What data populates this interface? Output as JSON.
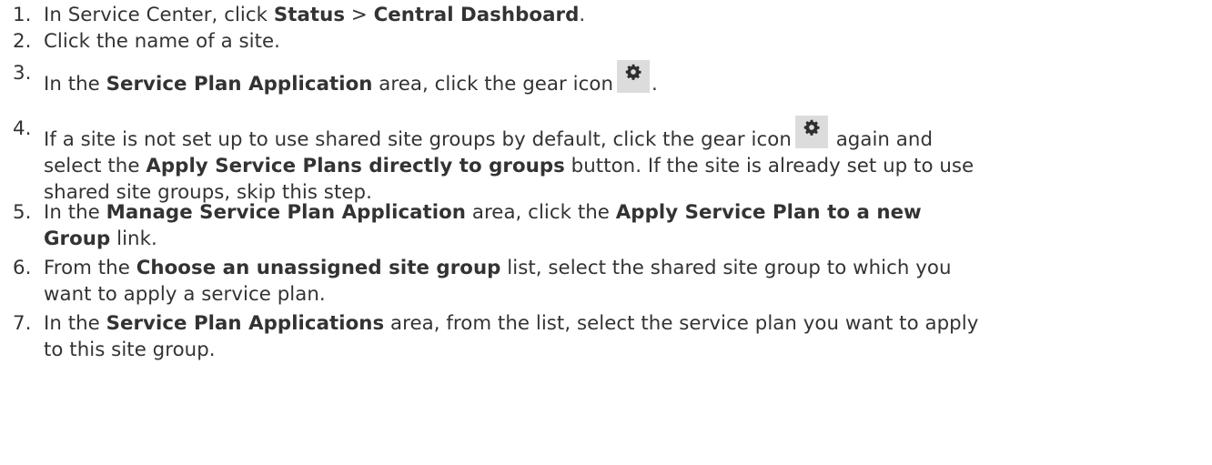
{
  "steps": [
    {
      "num": "1.",
      "parts": [
        "In Service Center, click ",
        "Status",
        " > ",
        "Central Dashboard",
        "."
      ]
    },
    {
      "num": "2.",
      "parts": [
        "Click the name of a site."
      ]
    },
    {
      "num": "3.",
      "parts": [
        "In the ",
        "Service Plan Application",
        " area, click the gear icon",
        "."
      ]
    },
    {
      "num": "4.",
      "parts": [
        "If a site is not set up to use shared site groups by default, click the gear icon",
        " again and",
        "select the ",
        "Apply Service Plans directly to groups",
        " button. If the site is already set up to use",
        "shared site groups, skip this step."
      ]
    },
    {
      "num": "5.",
      "parts": [
        "In the ",
        "Manage Service Plan Application",
        " area, click the ",
        "Apply Service Plan to a new",
        "Group",
        " link."
      ]
    },
    {
      "num": "6.",
      "parts": [
        "From the ",
        "Choose an unassigned site group",
        " list, select the shared site group to which you",
        "want to apply a service plan."
      ]
    },
    {
      "num": "7.",
      "parts": [
        "In the ",
        "Service Plan Applications",
        " area, from the list, select the service plan you want to apply",
        "to this site group."
      ]
    }
  ],
  "icons": {
    "gear": "gear-icon",
    "gear_color": "#2e2e2e",
    "gear_bg": "#dcdcdc"
  }
}
